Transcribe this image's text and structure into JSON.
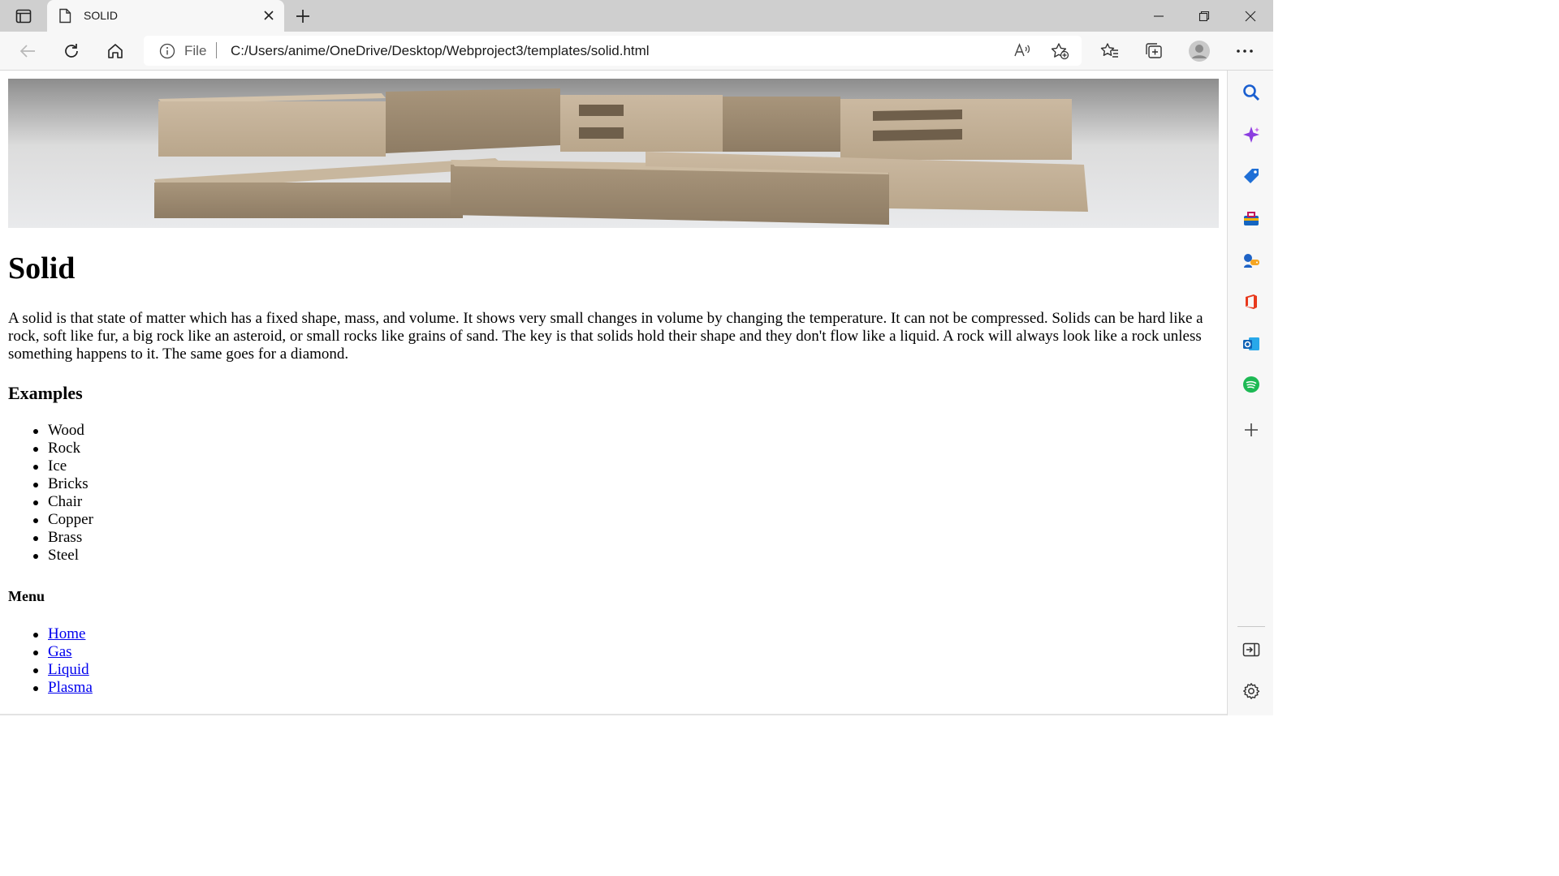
{
  "browser": {
    "tab_title": "SOLID",
    "address": {
      "scheme_label": "File",
      "url": "C:/Users/anime/OneDrive/Desktop/Webproject3/templates/solid.html"
    }
  },
  "icons": {
    "tab_actions": "tab-actions-icon",
    "page": "page-icon",
    "close": "close-icon",
    "new_tab": "plus-icon",
    "back": "back-arrow-icon",
    "refresh": "refresh-icon",
    "home": "home-icon",
    "info": "info-icon",
    "read_aloud": "read-aloud-icon",
    "add_favorite": "add-favorite-icon",
    "favorites": "favorites-icon",
    "collections": "collections-icon",
    "profile": "profile-icon",
    "more": "more-icon",
    "sidebar": [
      "search-icon",
      "copilot-icon",
      "shopping-icon",
      "tools-icon",
      "games-icon",
      "office-icon",
      "outlook-icon",
      "spotify-icon",
      "add-icon",
      "hide-sidebar-icon",
      "settings-icon"
    ]
  },
  "page": {
    "heading": "Solid",
    "description": "A solid is that state of matter which has a fixed shape, mass, and volume. It shows very small changes in volume by changing the temperature. It can not be compressed. Solids can be hard like a rock, soft like fur, a big rock like an asteroid, or small rocks like grains of sand. The key is that solids hold their shape and they don't flow like a liquid. A rock will always look like a rock unless something happens to it. The same goes for a diamond.",
    "examples_heading": "Examples",
    "examples": [
      "Wood",
      "Rock",
      "Ice",
      "Bricks",
      "Chair",
      "Copper",
      "Brass",
      "Steel"
    ],
    "menu_heading": "Menu",
    "menu": [
      "Home",
      "Gas",
      "Liquid",
      "Plasma"
    ]
  },
  "colors": {
    "link": "#0000ee",
    "chrome_bg": "#f7f7f7",
    "tabstrip_bg": "#cfcfcf"
  }
}
